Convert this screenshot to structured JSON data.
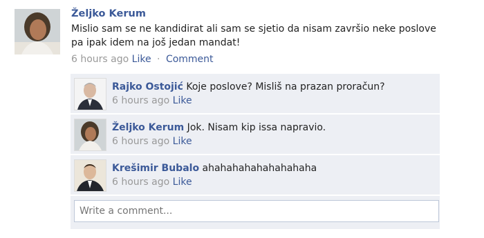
{
  "post": {
    "author": "Željko Kerum",
    "text_line1": "Mislio sam se ne kandidirat ali sam se sjetio da nisam završio neke poslove",
    "text_line2": "pa ipak idem na još jedan mandat!",
    "timestamp": "6 hours ago",
    "like_label": "Like",
    "separator": "·",
    "comment_label": "Comment"
  },
  "comments": [
    {
      "author": "Rajko Ostojić",
      "text": " Koje poslove? Misliš na prazan proračun?",
      "timestamp": "6 hours ago",
      "like_label": "Like"
    },
    {
      "author": "Željko Kerum",
      "text": " Jok. Nisam kip issa napravio.",
      "timestamp": "6 hours ago",
      "like_label": "Like"
    },
    {
      "author": "Krešimir Bubalo",
      "text": " ahahahahahahahahaha",
      "timestamp": "6 hours ago",
      "like_label": "Like"
    }
  ],
  "write_comment": {
    "placeholder": "Write a comment..."
  },
  "colors": {
    "link": "#3b5998",
    "meta": "#999999",
    "comment_bg": "#edeff4"
  }
}
